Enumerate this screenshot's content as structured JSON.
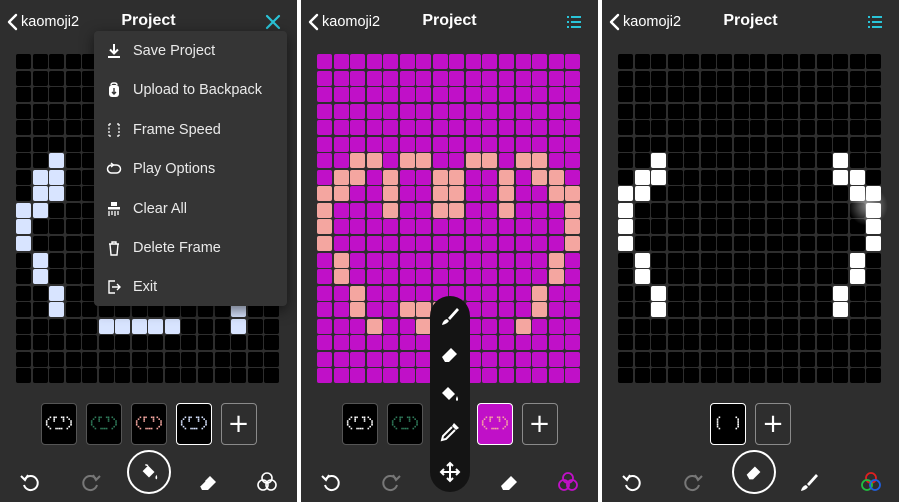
{
  "header": {
    "back_label": "kaomoji2",
    "title": "Project"
  },
  "menu": {
    "items": [
      {
        "label": "Save Project",
        "icon": "download-icon"
      },
      {
        "label": "Upload to Backpack",
        "icon": "backpack-icon"
      },
      {
        "label": "Frame Speed",
        "icon": "frame-speed-icon"
      },
      {
        "label": "Play Options",
        "icon": "loop-icon"
      },
      {
        "label": "Clear All",
        "icon": "clear-icon"
      },
      {
        "label": "Delete Frame",
        "icon": "trash-icon"
      },
      {
        "label": "Exit",
        "icon": "exit-icon"
      }
    ]
  },
  "colors": {
    "panel_bg": "#2e2e2e",
    "cell_off": "#000000",
    "accent": "#2ac4d8",
    "magenta": "#c010c8",
    "salmon": "#f4a6a0",
    "pale_blue": "#d8e4ff",
    "white": "#ffffff"
  },
  "frames_add_label": "+",
  "toolbar_icons": [
    "undo-icon",
    "redo-icon",
    "fill-icon",
    "eraser-icon",
    "color-palette-icon",
    "brush-icon",
    "move-icon",
    "eyedropper-icon"
  ]
}
